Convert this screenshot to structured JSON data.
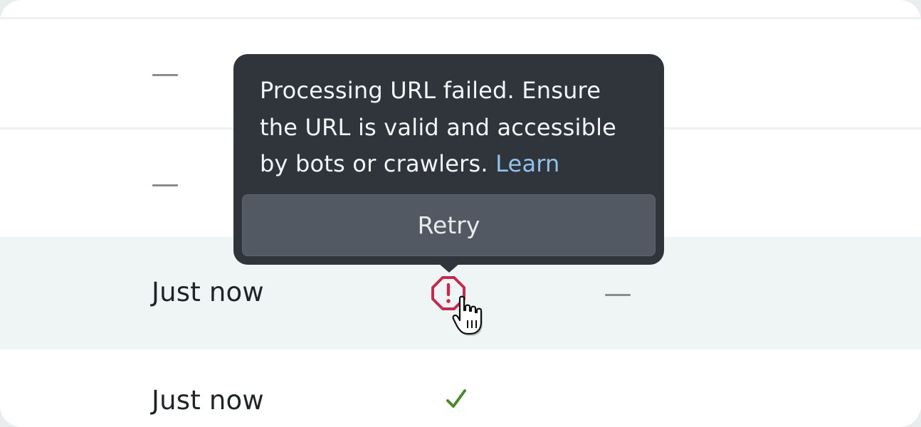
{
  "rows": [
    {
      "time": "",
      "status": "none",
      "extra": "none"
    },
    {
      "time": "",
      "status": "dash",
      "extra": "none"
    },
    {
      "time": "",
      "status": "dash",
      "extra": "none"
    },
    {
      "time": "Just now",
      "status": "error-icon",
      "extra": "dash"
    },
    {
      "time": "Just now",
      "status": "check-icon",
      "extra": "none"
    }
  ],
  "tooltip": {
    "message": "Processing URL failed. Ensure the URL is valid and accessible by bots or crawlers.",
    "link_label": "Learn",
    "retry_label": "Retry"
  },
  "colors": {
    "error": "#c42a4c",
    "success": "#4a8a2e",
    "tooltip_bg": "#30353c",
    "link": "#8fc3ee",
    "highlight_row": "#eff5f5"
  }
}
